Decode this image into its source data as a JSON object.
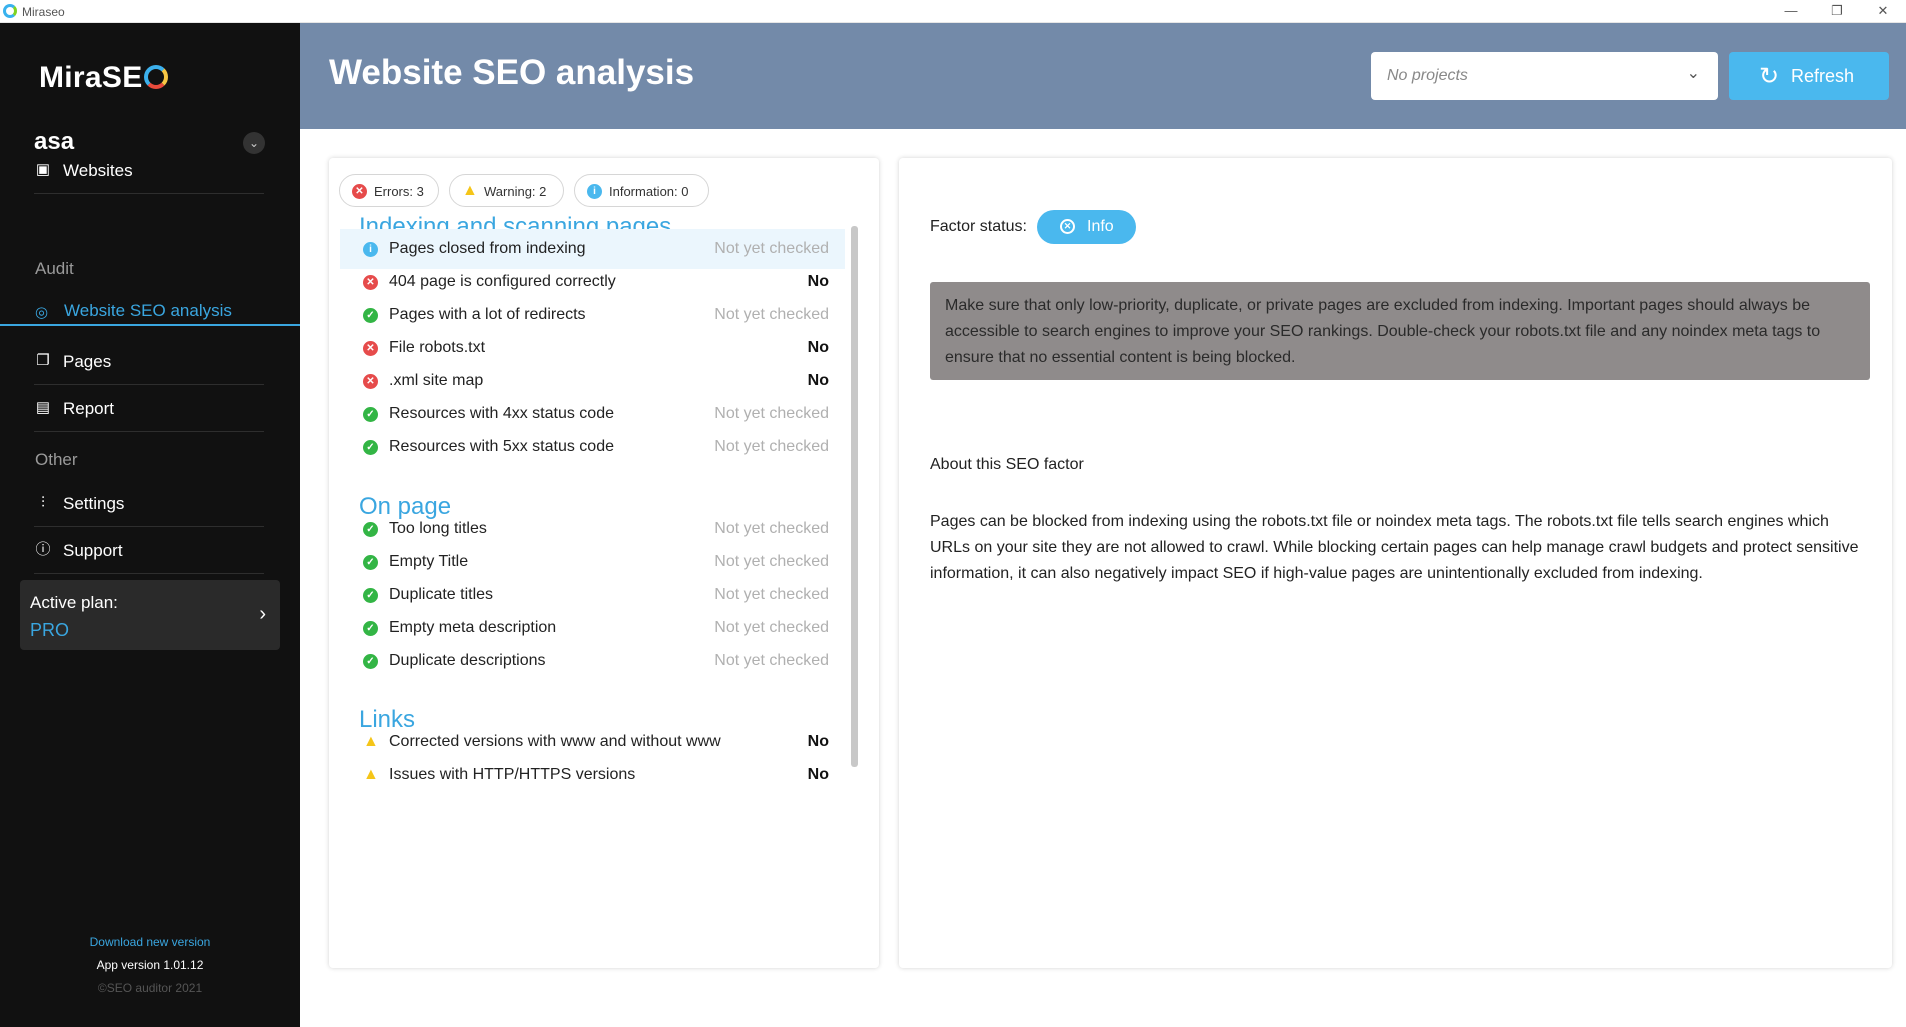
{
  "window": {
    "title": "Miraseo",
    "minimize_glyph": "—",
    "restore_glyph": "❐",
    "close_glyph": "✕"
  },
  "sidebar": {
    "logo_text": "MiraSE",
    "user_name": "asa",
    "items": [
      {
        "label": "Websites",
        "icon": "briefcase-icon"
      },
      {
        "label": "Pages",
        "icon": "pages-icon"
      },
      {
        "label": "Report",
        "icon": "report-icon"
      },
      {
        "label": "Settings",
        "icon": "sliders-icon"
      },
      {
        "label": "Support",
        "icon": "help-icon"
      }
    ],
    "audit_label": "Audit",
    "active_item": {
      "label": "Website SEO analysis",
      "icon": "analysis-icon"
    },
    "other_label": "Other",
    "plan": {
      "label": "Active plan:",
      "value": "PRO"
    },
    "download_label": "Download new version",
    "version_label": "App version 1.01.12",
    "copyright": "©SEO auditor 2021"
  },
  "header": {
    "title": "Website SEO analysis",
    "project_select": {
      "value": "No projects"
    },
    "refresh_label": "Refresh"
  },
  "summary": {
    "errors": "Errors: 3",
    "warnings": "Warning: 2",
    "information": "Information: 0"
  },
  "groups": [
    {
      "title": "Indexing and scanning pages",
      "rows": [
        {
          "label": "Pages closed from indexing",
          "status": "Not yet checked",
          "icon": "info-icon",
          "selected": true
        },
        {
          "label": "404 page is configured correctly",
          "status": "No",
          "icon": "error-icon"
        },
        {
          "label": "Pages with a lot of redirects",
          "status": "Not yet checked",
          "icon": "check-icon"
        },
        {
          "label": "File robots.txt",
          "status": "No",
          "icon": "error-icon"
        },
        {
          "label": ".xml site map",
          "status": "No",
          "icon": "error-icon"
        },
        {
          "label": "Resources with 4xx status code",
          "status": "Not yet checked",
          "icon": "check-icon"
        },
        {
          "label": "Resources with 5xx status code",
          "status": "Not yet checked",
          "icon": "check-icon"
        }
      ]
    },
    {
      "title": "On page",
      "rows": [
        {
          "label": "Too long titles",
          "status": "Not yet checked",
          "icon": "check-icon"
        },
        {
          "label": "Empty Title",
          "status": "Not yet checked",
          "icon": "check-icon"
        },
        {
          "label": "Duplicate titles",
          "status": "Not yet checked",
          "icon": "check-icon"
        },
        {
          "label": "Empty meta description",
          "status": "Not yet checked",
          "icon": "check-icon"
        },
        {
          "label": "Duplicate descriptions",
          "status": "Not yet checked",
          "icon": "check-icon"
        }
      ]
    },
    {
      "title": "Links",
      "rows": [
        {
          "label": "Corrected versions with www and without www",
          "status": "No",
          "icon": "warning-icon"
        },
        {
          "label": "Issues with HTTP/HTTPS versions",
          "status": "No",
          "icon": "warning-icon"
        }
      ]
    }
  ],
  "detail": {
    "factor_status_label": "Factor status:",
    "factor_status_value": "Info",
    "notice": "Make sure that only low-priority, duplicate, or private pages are excluded from indexing. Important pages should always be accessible to search engines to improve your SEO rankings. Double-check your robots.txt file and any noindex meta tags to ensure that no essential content is being blocked.",
    "about_title": "About this SEO factor",
    "about_text": "Pages can be blocked from indexing using the robots.txt file or noindex meta tags. The robots.txt file tells search engines which URLs on your site they are not allowed to crawl. While blocking certain pages can help manage crawl budgets and protect sensitive information, it can also negatively impact SEO if high-value pages are unintentionally excluded from indexing."
  },
  "colors": {
    "accent": "#3aa6e0",
    "header_bg": "#738aa9",
    "sidebar_bg": "#111111",
    "error": "#e64b4b",
    "success": "#33b545",
    "warning": "#f5c518",
    "notice_bg": "#8f8b8b"
  }
}
